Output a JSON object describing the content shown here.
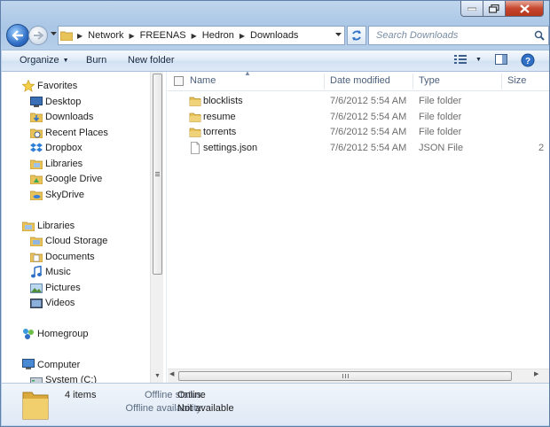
{
  "address": {
    "crumbs": [
      "Network",
      "FREENAS",
      "Hedron",
      "Downloads"
    ]
  },
  "search": {
    "placeholder": "Search Downloads"
  },
  "toolbar": {
    "organize": "Organize",
    "burn": "Burn",
    "new_folder": "New folder"
  },
  "nav": {
    "favorites": {
      "label": "Favorites",
      "items": [
        "Desktop",
        "Downloads",
        "Recent Places",
        "Dropbox",
        "Libraries",
        "Google Drive",
        "SkyDrive"
      ]
    },
    "libraries": {
      "label": "Libraries",
      "items": [
        "Cloud Storage",
        "Documents",
        "Music",
        "Pictures",
        "Videos"
      ]
    },
    "homegroup": "Homegroup",
    "computer": {
      "label": "Computer",
      "items": [
        "System (C:)"
      ]
    }
  },
  "columns": {
    "name": "Name",
    "date": "Date modified",
    "type": "Type",
    "size": "Size"
  },
  "files": [
    {
      "name": "blocklists",
      "date": "7/6/2012 5:54 AM",
      "type": "File folder",
      "size": "",
      "icon": "folder-icon"
    },
    {
      "name": "resume",
      "date": "7/6/2012 5:54 AM",
      "type": "File folder",
      "size": "",
      "icon": "folder-icon"
    },
    {
      "name": "torrents",
      "date": "7/6/2012 5:54 AM",
      "type": "File folder",
      "size": "",
      "icon": "folder-icon"
    },
    {
      "name": "settings.json",
      "date": "7/6/2012 5:54 AM",
      "type": "JSON File",
      "size": "2",
      "icon": "file-icon"
    }
  ],
  "details": {
    "count": "4 items",
    "offline_status_label": "Offline status:",
    "offline_status_value": "Online",
    "offline_availability_label": "Offline availability:",
    "offline_availability_value": "Not available"
  },
  "colors": {
    "accent": "#2f6fc6",
    "folder": "#e8c35a",
    "window_frame": "#a9c6e6"
  }
}
